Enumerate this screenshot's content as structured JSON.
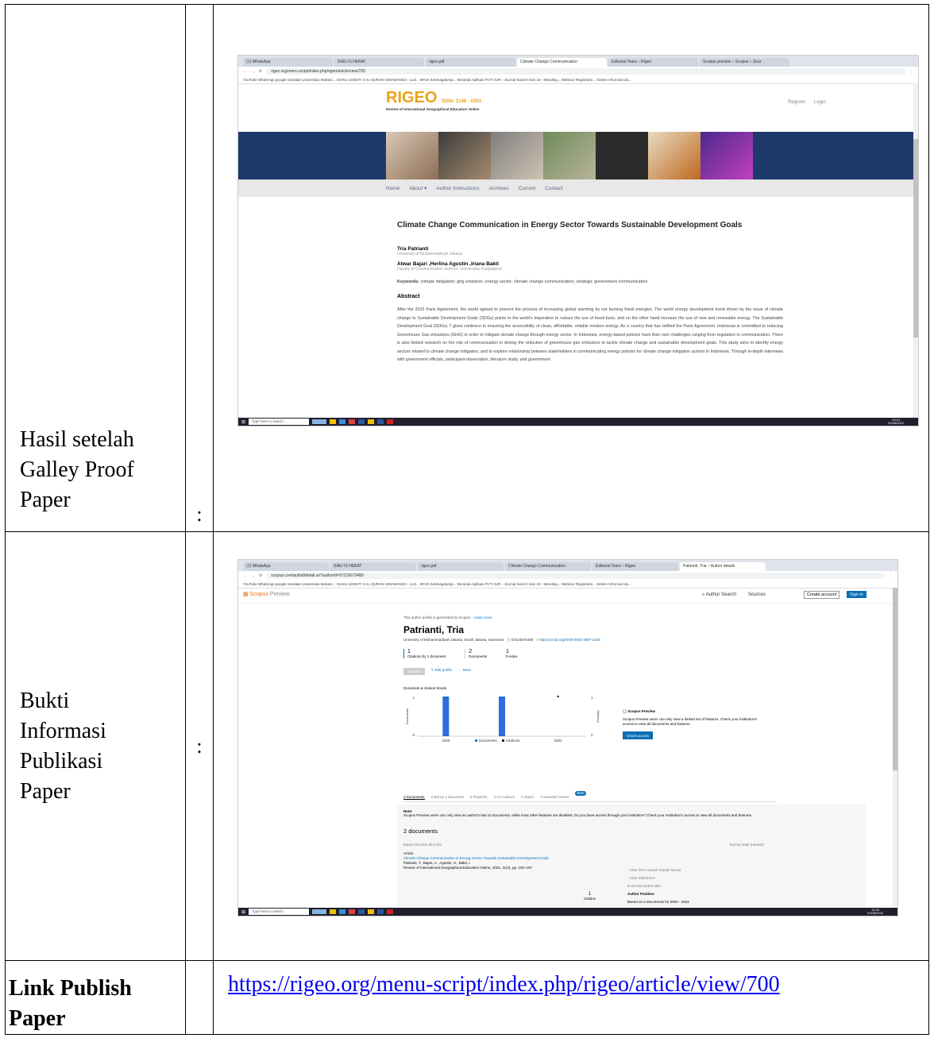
{
  "rows": [
    {
      "label": "Hasil setelah Galley Proof Paper",
      "colon": ":"
    },
    {
      "label": "Bukti Informasi Publikasi Paper",
      "colon": ":"
    },
    {
      "label": "Link Publish Paper",
      "link": "https://rigeo.org/menu-script/index.php/rigeo/article/view/700"
    }
  ],
  "shot1": {
    "tabs": [
      "(1) WhatsApp",
      "SIAU IS HEBAT",
      "rigeo.pdf",
      "Climate Change Communication",
      "Editorial Team – Rigeo",
      "Scopus preview – Scopus – Sour"
    ],
    "url": "rigeo.org/menu-script/index.php/rigeo/article/view/700",
    "bookmarks": "YouTube   WhatsApp   google translate   Universitas Muham...   SIAKU LENKITI II   AL-QURAN   SIMAWANG3 - LLD...   BPJS Ketenagakerja...   Beranda Aplikasi PCTI   SJR - Journal Search   Hari 19 - Mending...   Webinar Registratio...   Sistem Informasi da...",
    "logo": "RIGEO",
    "issn": "ISSN: 2146 - 0353",
    "journal": "Review of International Geographical Education Online",
    "register": "Register",
    "login": "Login",
    "nav": [
      "Home",
      "About",
      "Author Instructions",
      "Archives",
      "Current",
      "Contact"
    ],
    "title": "Climate Change Communication in Energy Sector Towards Sustainable Development Goals",
    "author1": "Tria Patrianti",
    "aff1": "University of Muhammadiyah Jakarta",
    "author2": "Atwar Bajari ,Herlina Agustin ,Iriana Bakti",
    "aff2": "Faculty of Communication Science, Universitas Padjadjaran",
    "keywords_label": "Keywords:",
    "keywords": "climate mitigation; ghg emission; energy sector; climate change communication; strategic government communication",
    "abstract_head": "Abstract",
    "abstract": "After the 2015 Paris Agreement, the world agreed to prevent the process of increasing global warming by not burning fossil energies. The world energy development trend driven by the issue of climate change to Sustainable Development Goals (SDGs) points to the world's imperative to reduce the use of fossil fuels, and on the other hand increase the use of new and renewable energy. The Sustainable Development Goal (SDGs) 7 gives credence to ensuring the accessibility of clean, affordable, reliable modern energy. As a country that has ratified the Paris Agreement, Indonesia is committed to reducing Greenhouse Gas emissions (GHG) in order to mitigate climate change through energy sector. In Indonesia, energy-based policies have their own challenges ranging from regulation to communication. There is also limited research on the role of communication in driving the reduction of greenhouse gas emissions to tackle climate change and sustainable development goals. This study aims to identify energy sectors related to climate change mitigation, and to explore relationship between stakeholders in communicating energy policies for climate change mitigation actions in Indonesia. Through in-depth interviews with government officials, participant-observation, literature study, and government",
    "search": "Type here to search",
    "time": "10:24",
    "date": "01/08/2022"
  },
  "shot2": {
    "tabs": [
      "(1) WhatsApp",
      "SIAU IS HEBAT",
      "rigeo.pdf",
      "Climate Change Communication",
      "Editorial Team – Rigeo",
      "Patrianti, Tria – Author details"
    ],
    "url": "scopus.com/authid/detail.uri?authorId=57216670480",
    "bookmarks": "YouTube   WhatsApp   google translate   Universitas Muham...   SIAKU LENKITI II   AL-QURAN   SIMAWANG3 - LLD...   BPJS Ketenagakerja...   Beranda Aplikasi PCTI   SJR - Journal Search   Hari 19 - Mending...   Webinar Registratio...   Sistem Informasi da...",
    "brand": "Scopus",
    "brand_suffix": "Preview",
    "author_search": "Author Search",
    "sources": "Sources",
    "create": "Create account",
    "signin": "Sign in",
    "notice": "This author profile is generated by Scopus",
    "learn": "Learn more",
    "name": "Patrianti, Tria",
    "affil": "University of Muhammadiyah Jakarta, South Jakarta, Indonesia",
    "auth_id": "57216670480",
    "orcid": "https://orcid.org/0000-0002-3897-2316",
    "metrics": [
      {
        "value": "1",
        "label": "Citations by 1 document"
      },
      {
        "value": "2",
        "label": "Documents"
      },
      {
        "value": "1",
        "label": "h-index"
      }
    ],
    "set_alert": "Set alert",
    "edit_profile": "Edit profile",
    "more": "More",
    "trends_title": "Document & citation trends",
    "y_left": "Documents",
    "y_right": "Citations",
    "x_start": "2020",
    "x_end": "2022",
    "legend_docs": "Documents",
    "legend_cit": "Citations",
    "preview_title": "Scopus Preview",
    "preview_text": "Scopus Preview users can only view a limited set of features. Check your institution's access to view all documents and features.",
    "check_access": "Check access",
    "subtabs": [
      "2 Documents",
      "Cited by 1 document",
      "0 Preprints",
      "4 Co-Authors",
      "0 Topics",
      "0 Awarded Grants"
    ],
    "beta": "Beta",
    "note_label": "Note:",
    "note": "Scopus Preview users can only view an author's last 10 documents, while most other features are disabled. Do you have access through your institution? Check your institution's access to view all documents and features.",
    "docs_head": "2 documents",
    "export": "Export all   Save all to list",
    "sort": "Sort by  Date (newest)",
    "doc_type": "Article",
    "doc_title": "Climate Change Communication in Energy Sector Towards Sustainable Development Goals",
    "doc_authors": "Patrianti, T., Bajari, A., Agustin, H., Bakti, I.",
    "doc_source": "Review of International Geographical Education Online, 2021, 11(4), pp. 102–107",
    "doc_cites": "1",
    "doc_cites_label": "Citation",
    "side_links": [
      "View list in search results format",
      "View references",
      "Set document alert"
    ],
    "author_position": "Author Position",
    "based_on": "Based on 2 documents for 2003 - 2022",
    "search": "Type here to search",
    "time": "10:25",
    "date": "01/08/2022"
  },
  "chart_data": {
    "type": "bar",
    "categories": [
      "2020",
      "2021",
      "2022"
    ],
    "series": [
      {
        "name": "Documents",
        "values": [
          1,
          1,
          0
        ]
      },
      {
        "name": "Citations",
        "values": [
          0,
          0,
          1
        ]
      }
    ],
    "ylabel": "Documents",
    "y2label": "Citations",
    "ylim": [
      0,
      1
    ],
    "colors": {
      "Documents": "#2d6ddf",
      "Citations": "#1a1a1a"
    }
  }
}
